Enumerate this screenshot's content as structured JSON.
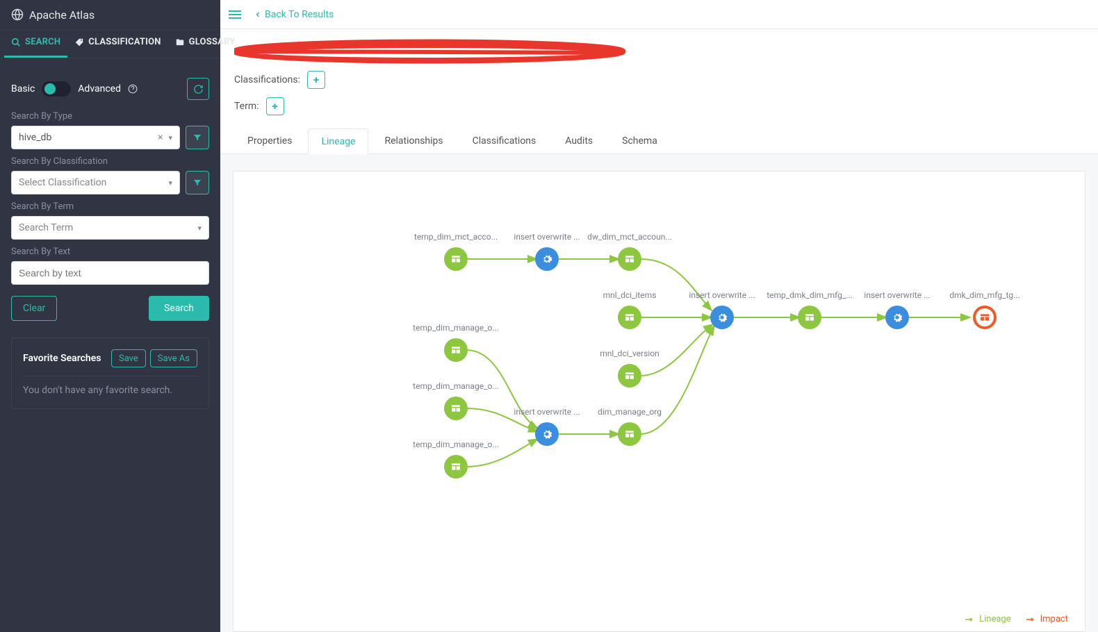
{
  "app_title": "Apache Atlas",
  "sidebar_tabs": {
    "search": "SEARCH",
    "classification": "CLASSIFICATION",
    "glossary": "GLOSSARY"
  },
  "mode": {
    "basic": "Basic",
    "advanced": "Advanced"
  },
  "form": {
    "type_label": "Search By Type",
    "type_value": "hive_db",
    "class_label": "Search By Classification",
    "class_placeholder": "Select Classification",
    "term_label": "Search By Term",
    "term_placeholder": "Search Term",
    "text_label": "Search By Text",
    "text_placeholder": "Search by text"
  },
  "buttons": {
    "clear": "Clear",
    "search": "Search",
    "save": "Save",
    "save_as": "Save As"
  },
  "fav": {
    "title": "Favorite Searches",
    "empty": "You don't have any favorite search."
  },
  "back": "Back To Results",
  "meta": {
    "classifications": "Classifications:",
    "term": "Term:"
  },
  "tabs": {
    "properties": "Properties",
    "lineage": "Lineage",
    "relationships": "Relationships",
    "classifications": "Classifications",
    "audits": "Audits",
    "schema": "Schema"
  },
  "legend": {
    "lineage": "Lineage",
    "impact": "Impact"
  },
  "nodes": {
    "n1": "temp_dim_mct_acco...",
    "n2": "insert overwrite ...",
    "n3": "dw_dim_mct_accoun...",
    "n4": "mnl_dci_items",
    "n5": "mnl_dci_version",
    "n6": "temp_dim_manage_o...",
    "n7": "temp_dim_manage_o...",
    "n8": "temp_dim_manage_o...",
    "n9": "insert overwrite ...",
    "n10": "dim_manage_org",
    "n11": "insert overwrite ...",
    "n12": "temp_dmk_dim_mfg_...",
    "n13": "insert overwrite ...",
    "n14": "dmk_dim_mfg_tg..."
  }
}
